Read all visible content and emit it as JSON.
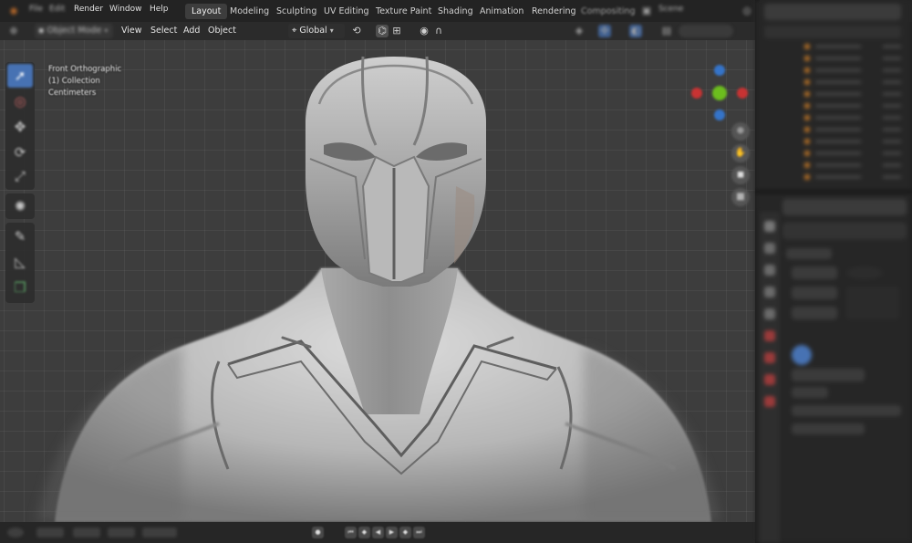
{
  "menu": {
    "file": "File",
    "edit": "Edit",
    "render": "Render",
    "window": "Window",
    "help": "Help"
  },
  "workspaces": [
    {
      "label": "Layout",
      "active": true
    },
    {
      "label": "Modeling",
      "active": false
    },
    {
      "label": "Sculpting",
      "active": false
    },
    {
      "label": "UV Editing",
      "active": false
    },
    {
      "label": "Texture Paint",
      "active": false
    },
    {
      "label": "Shading",
      "active": false
    },
    {
      "label": "Animation",
      "active": false
    },
    {
      "label": "Rendering",
      "active": false
    },
    {
      "label": "Compositing",
      "active": false
    }
  ],
  "scene": "Scene",
  "viewport_header": {
    "mode": "Object Mode",
    "view": "View",
    "select": "Select",
    "add": "Add",
    "object": "Object",
    "transform_orientation": "Global"
  },
  "overlay": {
    "view_name": "Front Orthographic",
    "collection": "(1) Collection",
    "units": "Centimeters"
  },
  "icons": {
    "cursor": "cursor-icon",
    "move": "move-icon",
    "rotate": "rotate-icon",
    "scale": "scale-icon",
    "transform": "transform-icon",
    "annotate": "annotate-icon",
    "measure": "measure-icon",
    "add_cube": "add-cube-icon"
  },
  "colors": {
    "accent": "#4772b3",
    "axis_x": "#c83333",
    "axis_y": "#6cbd1e",
    "axis_z": "#3574c9",
    "outliner_orange": "#c97b26"
  }
}
